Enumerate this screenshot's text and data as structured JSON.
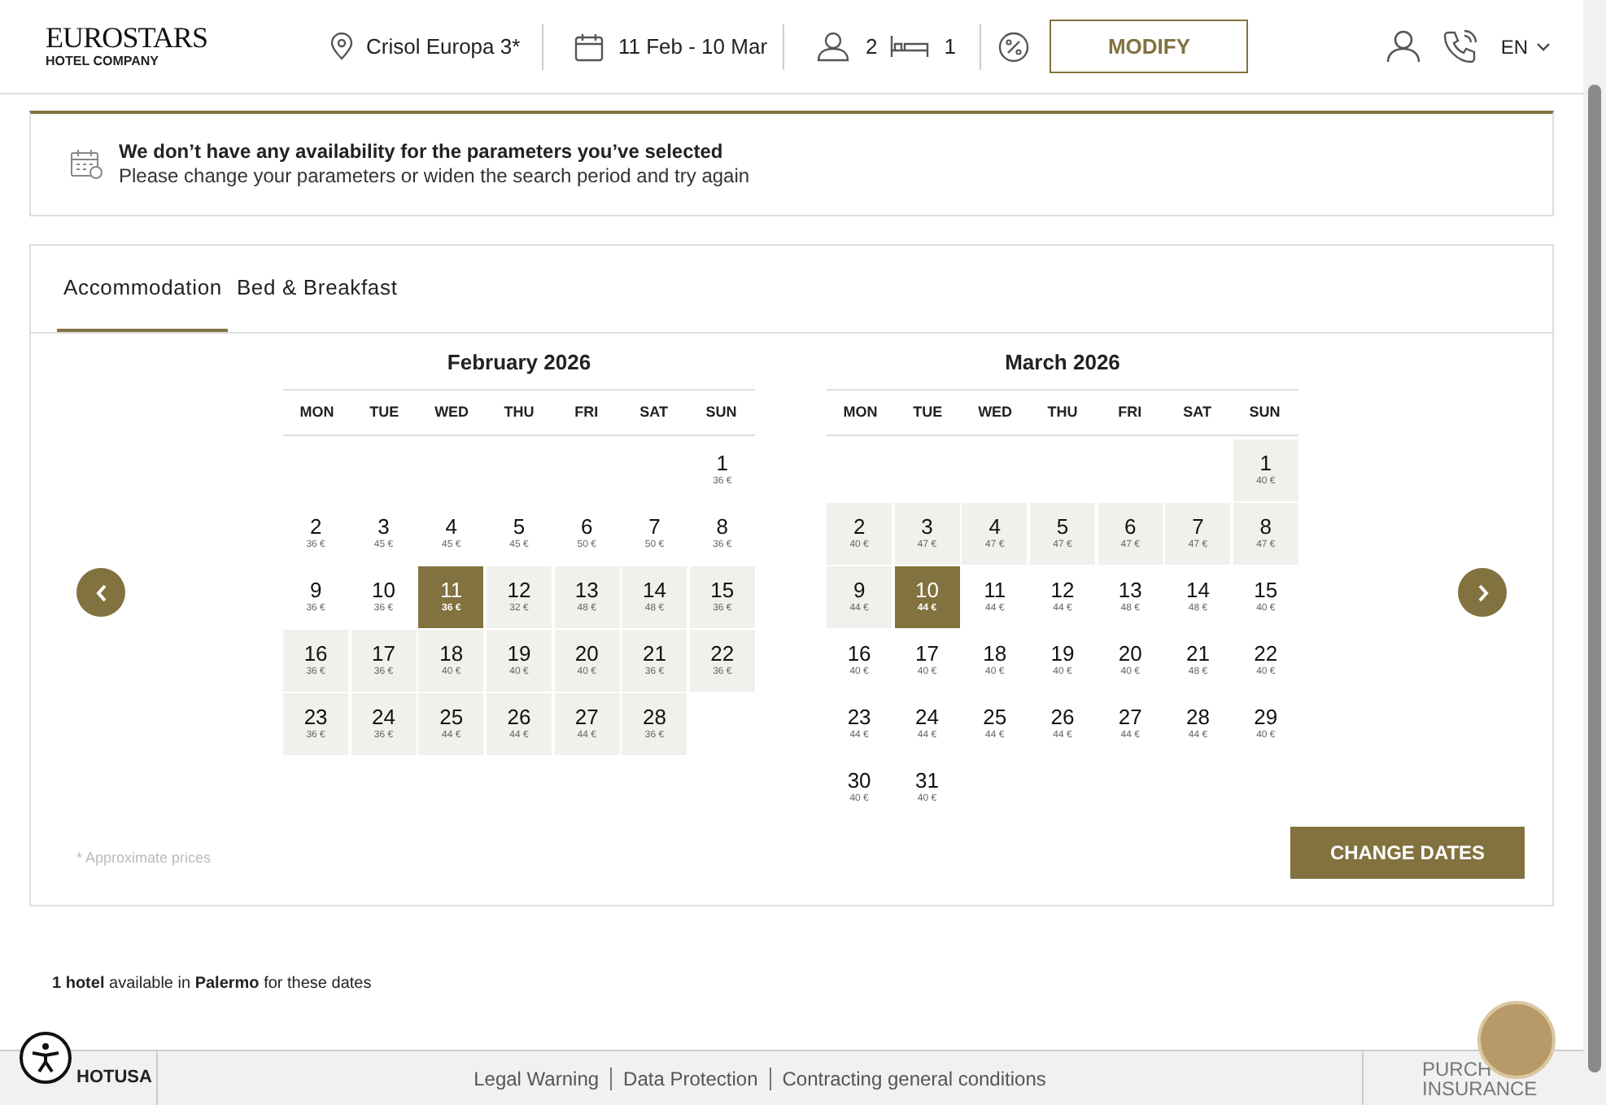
{
  "header": {
    "logo": {
      "name": "EUROSTARS",
      "tagline": "HOTEL COMPANY"
    },
    "hotel": "Crisol Europa 3*",
    "dates": "11 Feb - 10 Mar",
    "guests": "2",
    "rooms": "1",
    "modify_button": "MODIFY",
    "language": "EN"
  },
  "alert": {
    "title": "We don’t have any availability for the parameters you’ve selected",
    "message": "Please change your parameters or widen the search period and try again"
  },
  "tabs": [
    {
      "label": "Accommodation",
      "selected": true
    },
    {
      "label": "Bed & Breakfast",
      "selected": false
    }
  ],
  "months": [
    {
      "title": "February 2026",
      "weekdays": [
        "MON",
        "TUE",
        "WED",
        "THU",
        "FRI",
        "SAT",
        "SUN"
      ],
      "weeks": [
        [
          {
            "day": "1",
            "price": "36 €",
            "selected": false,
            "in_range": false
          }
        ],
        [
          {
            "day": "2",
            "price": "36 €",
            "selected": false,
            "in_range": false
          },
          {
            "day": "3",
            "price": "45 €",
            "selected": false,
            "in_range": false
          },
          {
            "day": "4",
            "price": "45 €",
            "selected": false,
            "in_range": false
          },
          {
            "day": "5",
            "price": "45 €",
            "selected": false,
            "in_range": false
          },
          {
            "day": "6",
            "price": "50 €",
            "selected": false,
            "in_range": false
          },
          {
            "day": "7",
            "price": "50 €",
            "selected": false,
            "in_range": false
          },
          {
            "day": "8",
            "price": "36 €",
            "selected": false,
            "in_range": false
          }
        ],
        [
          {
            "day": "9",
            "price": "36 €",
            "selected": false,
            "in_range": false
          },
          {
            "day": "10",
            "price": "36 €",
            "selected": false,
            "in_range": false
          },
          {
            "day": "11",
            "price": "36 €",
            "selected": true
          },
          {
            "day": "12",
            "price": "32 €",
            "selected": false,
            "in_range": true
          },
          {
            "day": "13",
            "price": "48 €",
            "selected": false,
            "in_range": true
          },
          {
            "day": "14",
            "price": "48 €",
            "selected": false,
            "in_range": true
          },
          {
            "day": "15",
            "price": "36 €",
            "selected": false,
            "in_range": true
          }
        ],
        [
          {
            "day": "16",
            "price": "36 €",
            "selected": false,
            "in_range": true
          },
          {
            "day": "17",
            "price": "36 €",
            "selected": false,
            "in_range": true
          },
          {
            "day": "18",
            "price": "40 €",
            "selected": false,
            "in_range": true
          },
          {
            "day": "19",
            "price": "40 €",
            "selected": false,
            "in_range": true
          },
          {
            "day": "20",
            "price": "40 €",
            "selected": false,
            "in_range": true
          },
          {
            "day": "21",
            "price": "36 €",
            "selected": false,
            "in_range": true
          },
          {
            "day": "22",
            "price": "36 €",
            "selected": false,
            "in_range": true
          }
        ],
        [
          {
            "day": "23",
            "price": "36 €",
            "selected": false,
            "in_range": true
          },
          {
            "day": "24",
            "price": "36 €",
            "selected": false,
            "in_range": true
          },
          {
            "day": "25",
            "price": "44 €",
            "selected": false,
            "in_range": true
          },
          {
            "day": "26",
            "price": "44 €",
            "selected": false,
            "in_range": true
          },
          {
            "day": "27",
            "price": "44 €",
            "selected": false,
            "in_range": true
          },
          {
            "day": "28",
            "price": "36 €",
            "selected": false,
            "in_range": true
          }
        ]
      ]
    },
    {
      "title": "March 2026",
      "weekdays": [
        "MON",
        "TUE",
        "WED",
        "THU",
        "FRI",
        "SAT",
        "SUN"
      ],
      "weeks": [
        [
          {
            "day": "1",
            "price": "40 €",
            "selected": false,
            "in_range": true
          }
        ],
        [
          {
            "day": "2",
            "price": "40 €",
            "selected": false,
            "in_range": true
          },
          {
            "day": "3",
            "price": "47 €",
            "selected": false,
            "in_range": true
          },
          {
            "day": "4",
            "price": "47 €",
            "selected": false,
            "in_range": true
          },
          {
            "day": "5",
            "price": "47 €",
            "selected": false,
            "in_range": true
          },
          {
            "day": "6",
            "price": "47 €",
            "selected": false,
            "in_range": true
          },
          {
            "day": "7",
            "price": "47 €",
            "selected": false,
            "in_range": true
          },
          {
            "day": "8",
            "price": "47 €",
            "selected": false,
            "in_range": true
          }
        ],
        [
          {
            "day": "9",
            "price": "44 €",
            "selected": false,
            "in_range": true
          },
          {
            "day": "10",
            "price": "44 €",
            "selected": true
          },
          {
            "day": "11",
            "price": "44 €",
            "selected": false,
            "in_range": false
          },
          {
            "day": "12",
            "price": "44 €",
            "selected": false,
            "in_range": false
          },
          {
            "day": "13",
            "price": "48 €",
            "selected": false,
            "in_range": false
          },
          {
            "day": "14",
            "price": "48 €",
            "selected": false,
            "in_range": false
          },
          {
            "day": "15",
            "price": "40 €",
            "selected": false,
            "in_range": false
          }
        ],
        [
          {
            "day": "16",
            "price": "40 €",
            "selected": false,
            "in_range": false
          },
          {
            "day": "17",
            "price": "40 €",
            "selected": false,
            "in_range": false
          },
          {
            "day": "18",
            "price": "40 €",
            "selected": false,
            "in_range": false
          },
          {
            "day": "19",
            "price": "40 €",
            "selected": false,
            "in_range": false
          },
          {
            "day": "20",
            "price": "40 €",
            "selected": false,
            "in_range": false
          },
          {
            "day": "21",
            "price": "48 €",
            "selected": false,
            "in_range": false
          },
          {
            "day": "22",
            "price": "40 €",
            "selected": false,
            "in_range": false
          }
        ],
        [
          {
            "day": "23",
            "price": "44 €",
            "selected": false,
            "in_range": false
          },
          {
            "day": "24",
            "price": "44 €",
            "selected": false,
            "in_range": false
          },
          {
            "day": "25",
            "price": "44 €",
            "selected": false,
            "in_range": false
          },
          {
            "day": "26",
            "price": "44 €",
            "selected": false,
            "in_range": false
          },
          {
            "day": "27",
            "price": "44 €",
            "selected": false,
            "in_range": false
          },
          {
            "day": "28",
            "price": "44 €",
            "selected": false,
            "in_range": false
          },
          {
            "day": "29",
            "price": "40 €",
            "selected": false,
            "in_range": false
          }
        ],
        [
          {
            "day": "30",
            "price": "40 €",
            "selected": false,
            "in_range": false
          },
          {
            "day": "31",
            "price": "40 €",
            "selected": false,
            "in_range": false
          }
        ]
      ]
    }
  ],
  "price_note": "* Approximate prices",
  "change_dates_button": "CHANGE DATES",
  "results_summary": "**1 hotel** available in **Palermo** for these dates",
  "footer": {
    "brand": "HOTUSA",
    "links": [
      "Legal Warning",
      "Data Protection",
      "Contracting general conditions"
    ],
    "insurance": [
      "PURCH",
      "INSURANCE"
    ]
  }
}
